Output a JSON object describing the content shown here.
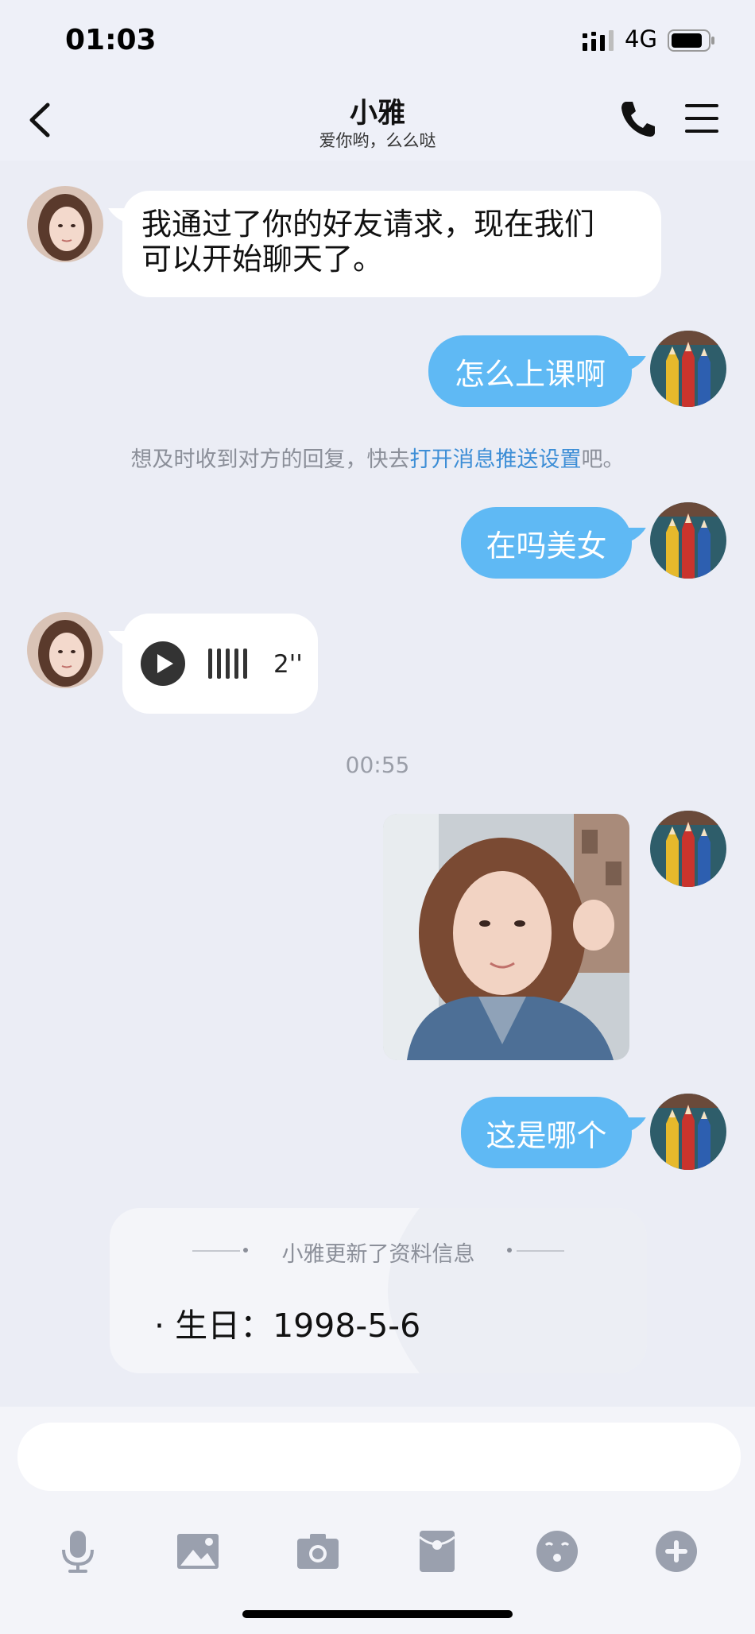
{
  "status_bar": {
    "time": "01:03",
    "network": "4G"
  },
  "header": {
    "title": "小雅",
    "subtitle": "爱你哟，么么哒"
  },
  "messages": {
    "m1": {
      "text_line1": "我通过了你的好友请求，现在我们",
      "text_line2": "可以开始聊天了。"
    },
    "m2": {
      "text": "怎么上课啊"
    },
    "notice": {
      "prefix": "想及时收到对方的回复，快去",
      "link": "打开消息推送设置",
      "suffix": "吧。"
    },
    "m3": {
      "text": "在吗美女"
    },
    "voice": {
      "duration": "2''"
    },
    "timestamp": "00:55",
    "m5": {
      "text": "这是哪个"
    }
  },
  "profile_card": {
    "title": "小雅更新了资料信息",
    "item": "· 生日：1998-5-6"
  },
  "input": {
    "placeholder": ""
  },
  "toolbar": {
    "icons": [
      "microphone-icon",
      "image-icon",
      "camera-icon",
      "red-packet-icon",
      "emoji-icon",
      "plus-icon"
    ]
  },
  "colors": {
    "outgoing_bubble": "#5fb9f4",
    "link": "#3d8ed6",
    "background": "#ebedf5",
    "toolbar_icon": "#9aa0ae"
  }
}
